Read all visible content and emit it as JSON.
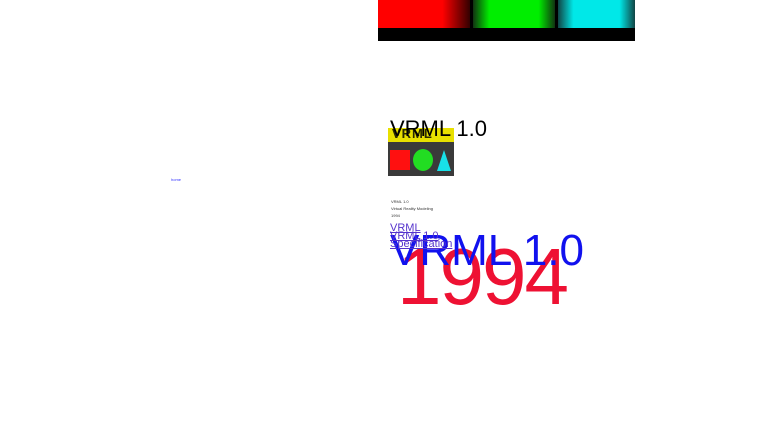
{
  "banner": {
    "swatches": [
      {
        "name": "red",
        "color": "#ff0000"
      },
      {
        "name": "green",
        "color": "#00ee00"
      },
      {
        "name": "cyan",
        "color": "#00e8e8"
      }
    ]
  },
  "thumbnail": {
    "ribbon_text": "VRML"
  },
  "heading": "VRML 1.0",
  "tiny_link": "home",
  "info_lines": [
    "VRML 1.0",
    "Virtual Reality Modeling",
    "1994"
  ],
  "link_stack": [
    "VRML",
    "VRML 1.0",
    "Specification"
  ],
  "overlay_blue": "VRML 1.0",
  "overlay_year": "1994",
  "colors": {
    "red": "#ee1133",
    "blue": "#1111ee",
    "purple": "#7733dd"
  }
}
